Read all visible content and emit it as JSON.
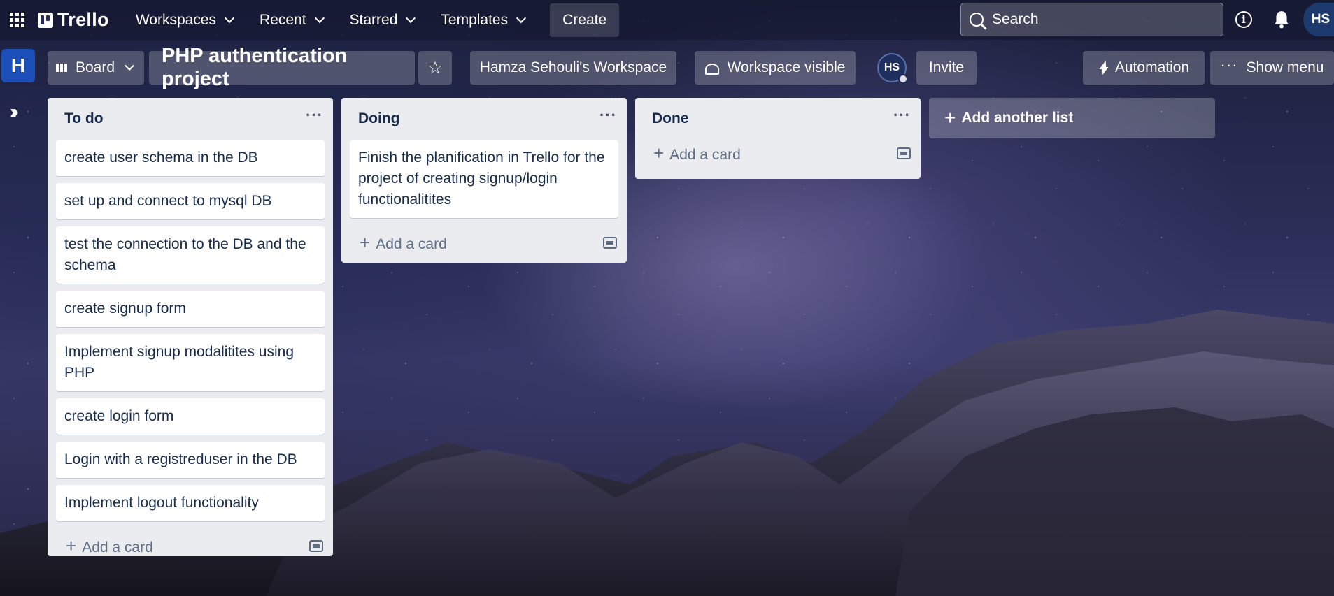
{
  "topbar": {
    "brand": "Trello",
    "nav": [
      {
        "label": "Workspaces"
      },
      {
        "label": "Recent"
      },
      {
        "label": "Starred"
      },
      {
        "label": "Templates"
      }
    ],
    "create_label": "Create",
    "search_placeholder": "Search",
    "avatar_initials": "HS"
  },
  "sidebar": {
    "workspace_initial": "H"
  },
  "board": {
    "view_label": "Board",
    "title": "PHP authentication project",
    "workspace_name": "Hamza Sehouli's Workspace",
    "visibility": "Workspace visible",
    "member_initials": "HS",
    "invite_label": "Invite",
    "automation_label": "Automation",
    "show_menu_label": "Show menu"
  },
  "lists": [
    {
      "title": "To do",
      "cards": [
        "create user schema in the DB",
        "set up and connect to mysql DB",
        "test the connection to the DB and the schema",
        "create signup form",
        "Implement signup modalitites using PHP",
        "create login form",
        "Login with a registreduser in the DB",
        "Implement logout functionality"
      ],
      "add_card_label": "Add a card"
    },
    {
      "title": "Doing",
      "cards": [
        "Finish the planification in Trello for the project of creating signup/login functionalitites"
      ],
      "add_card_label": "Add a card"
    },
    {
      "title": "Done",
      "cards": [],
      "add_card_label": "Add a card"
    }
  ],
  "add_list_label": "Add another list",
  "colors": {
    "workspace_badge": "#1c4fb8",
    "list_bg": "#ebecf0",
    "card_bg": "#ffffff",
    "text": "#172b4d"
  }
}
